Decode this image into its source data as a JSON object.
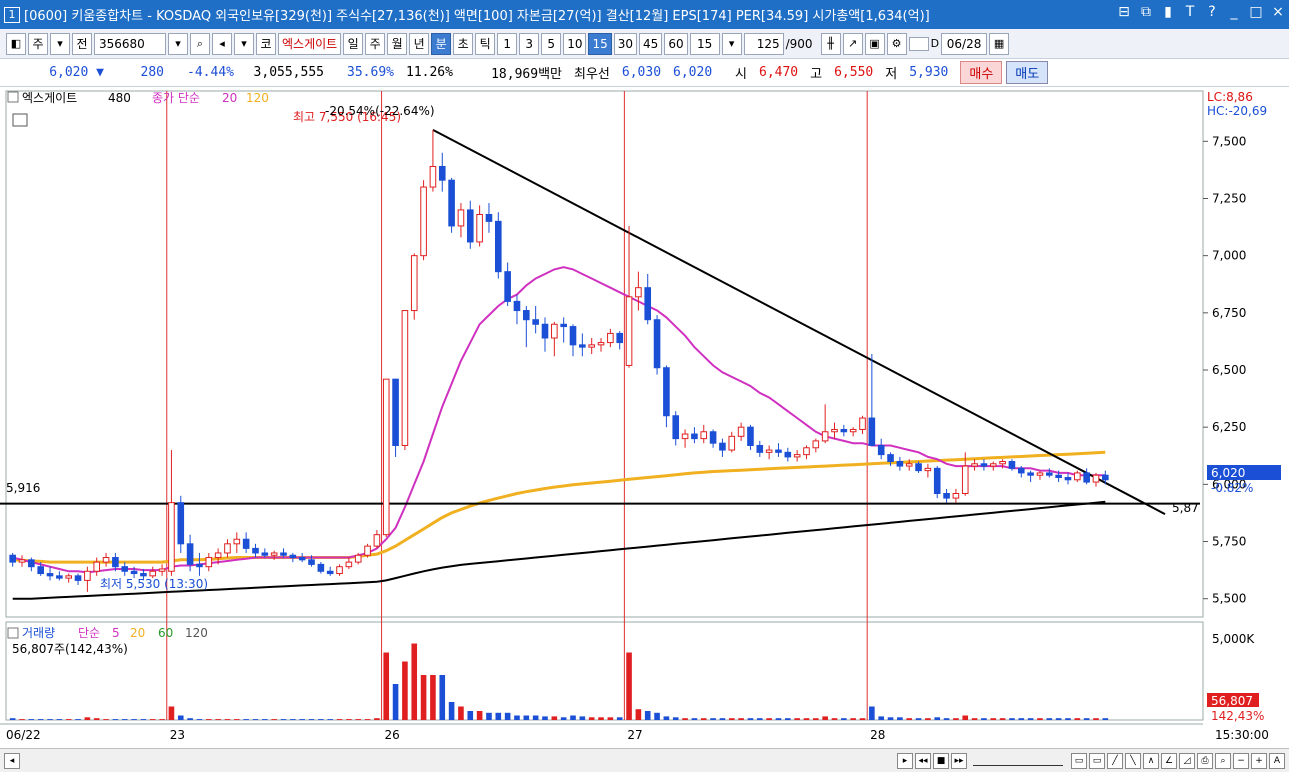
{
  "window": {
    "number": "1",
    "title": "[0600] 키움종합차트 - KOSDAQ 외국인보유[329(천)] 주식수[27,136(천)] 액면[100] 자본금[27(억)] 결산[12월] EPS[174] PER[34.59] 시가총액[1,634(억)]",
    "buttons": [
      "⊟",
      "⧉",
      "▮",
      "T",
      "?",
      "_",
      "□",
      "×"
    ]
  },
  "toolbar1": {
    "period_main": "주",
    "jeon": "전",
    "code": "356680",
    "ko": "코",
    "stock_name": "엑스게이트",
    "intervals": [
      "일",
      "주",
      "월",
      "년",
      "분",
      "초",
      "틱"
    ],
    "selected_interval": "분",
    "minutes": [
      "1",
      "3",
      "5",
      "10",
      "15",
      "30",
      "45",
      "60"
    ],
    "selected_minute": "15",
    "minute_select": "15",
    "count": "125",
    "count_total": "/900",
    "d_label": "D",
    "date": "06/28"
  },
  "quote": {
    "price": "6,020",
    "arrow": "▼",
    "change": "280",
    "change_pct": "-4.44%",
    "volume": "3,055,555",
    "ratio1": "35.69%",
    "ratio2": "11.26%",
    "amount": "18,969백만",
    "best_label": "최우선",
    "best_ask": "6,030",
    "best_bid": "6,020",
    "open_label": "시",
    "open": "6,470",
    "high_label": "고",
    "high": "6,550",
    "low_label": "저",
    "low": "5,930",
    "buy_label": "매수",
    "sell_label": "매도"
  },
  "chart_legend": {
    "name": "엑스게이트",
    "count": "480",
    "ma_label": "종가 단순",
    "ma_a": "20",
    "ma_b": "120",
    "high_label": "최고 7,550 (16:45)",
    "trend_label": "-20.54%(-22.64%)",
    "low_label": "최저 5,530 (13:30)",
    "hline_label": "5,916",
    "trend_end_label": "5,87",
    "lc": "LC:8,86",
    "hc": "HC:-20,69",
    "current_price": "6,020",
    "current_pct": "-0.82%"
  },
  "volume_legend": {
    "name": "거래량",
    "ma_label": "단순",
    "ma_a": "5",
    "ma_b": "20",
    "ma_c": "60",
    "ma_d": "120",
    "info": "56,807주(142,43%)",
    "axis_top": "5,000K",
    "current": "56,807",
    "current_pct": "142,43%"
  },
  "x_labels": [
    "06/22",
    "23",
    "26",
    "27",
    "28"
  ],
  "time_label": "15:30:00",
  "colors": {
    "up": "#e02020",
    "down": "#1a4fd6",
    "ma20": "#d030c0",
    "ma120": "#f0b020",
    "trend": "#000000"
  },
  "chart_data": {
    "type": "candlestick",
    "y_ticks": [
      5500,
      5750,
      6000,
      6250,
      6500,
      6750,
      7000,
      7250,
      7500
    ],
    "ylim": [
      5420,
      7720
    ],
    "day_labels": [
      "06/22",
      "23",
      "26",
      "27",
      "28"
    ],
    "hline": 5916,
    "candles": [
      [
        5690,
        5700,
        5640,
        5660
      ],
      [
        5660,
        5690,
        5640,
        5670
      ],
      [
        5670,
        5680,
        5620,
        5640
      ],
      [
        5640,
        5660,
        5600,
        5610
      ],
      [
        5610,
        5640,
        5580,
        5600
      ],
      [
        5600,
        5620,
        5580,
        5590
      ],
      [
        5590,
        5610,
        5570,
        5600
      ],
      [
        5600,
        5610,
        5560,
        5580
      ],
      [
        5580,
        5640,
        5530,
        5620
      ],
      [
        5620,
        5680,
        5600,
        5660
      ],
      [
        5660,
        5700,
        5640,
        5680
      ],
      [
        5680,
        5700,
        5620,
        5640
      ],
      [
        5640,
        5660,
        5600,
        5620
      ],
      [
        5620,
        5640,
        5590,
        5610
      ],
      [
        5610,
        5630,
        5580,
        5600
      ],
      [
        5600,
        5640,
        5590,
        5620
      ],
      [
        5620,
        5650,
        5600,
        5630
      ],
      [
        5620,
        6150,
        5600,
        5920
      ],
      [
        5920,
        5950,
        5700,
        5740
      ],
      [
        5740,
        5780,
        5620,
        5650
      ],
      [
        5650,
        5700,
        5600,
        5640
      ],
      [
        5640,
        5700,
        5620,
        5680
      ],
      [
        5680,
        5720,
        5650,
        5700
      ],
      [
        5700,
        5760,
        5680,
        5740
      ],
      [
        5740,
        5790,
        5700,
        5760
      ],
      [
        5760,
        5790,
        5700,
        5720
      ],
      [
        5720,
        5740,
        5680,
        5700
      ],
      [
        5700,
        5720,
        5680,
        5690
      ],
      [
        5690,
        5710,
        5670,
        5700
      ],
      [
        5700,
        5720,
        5680,
        5690
      ],
      [
        5690,
        5700,
        5660,
        5680
      ],
      [
        5680,
        5700,
        5660,
        5670
      ],
      [
        5670,
        5690,
        5640,
        5650
      ],
      [
        5650,
        5660,
        5610,
        5620
      ],
      [
        5620,
        5640,
        5600,
        5610
      ],
      [
        5610,
        5650,
        5600,
        5640
      ],
      [
        5640,
        5680,
        5630,
        5660
      ],
      [
        5660,
        5700,
        5650,
        5690
      ],
      [
        5690,
        5740,
        5680,
        5730
      ],
      [
        5730,
        5800,
        5720,
        5780
      ],
      [
        5780,
        6460,
        5770,
        6460
      ],
      [
        6460,
        6460,
        6120,
        6170
      ],
      [
        6170,
        6760,
        6150,
        6760
      ],
      [
        6760,
        7010,
        6720,
        7000
      ],
      [
        7000,
        7330,
        6980,
        7300
      ],
      [
        7300,
        7550,
        7280,
        7390
      ],
      [
        7390,
        7450,
        7280,
        7330
      ],
      [
        7330,
        7340,
        7100,
        7130
      ],
      [
        7130,
        7230,
        7080,
        7200
      ],
      [
        7200,
        7240,
        7030,
        7060
      ],
      [
        7060,
        7220,
        7040,
        7180
      ],
      [
        7180,
        7230,
        7100,
        7150
      ],
      [
        7150,
        7190,
        6900,
        6930
      ],
      [
        6930,
        6970,
        6780,
        6800
      ],
      [
        6800,
        6830,
        6700,
        6760
      ],
      [
        6760,
        6780,
        6600,
        6720
      ],
      [
        6720,
        6780,
        6660,
        6700
      ],
      [
        6700,
        6730,
        6580,
        6640
      ],
      [
        6640,
        6710,
        6560,
        6700
      ],
      [
        6700,
        6730,
        6620,
        6690
      ],
      [
        6690,
        6700,
        6560,
        6610
      ],
      [
        6610,
        6660,
        6560,
        6600
      ],
      [
        6600,
        6640,
        6570,
        6610
      ],
      [
        6610,
        6640,
        6580,
        6620
      ],
      [
        6620,
        6680,
        6600,
        6660
      ],
      [
        6660,
        6670,
        6590,
        6620
      ],
      [
        6520,
        7130,
        6510,
        6820
      ],
      [
        6820,
        6930,
        6760,
        6860
      ],
      [
        6860,
        6920,
        6700,
        6720
      ],
      [
        6720,
        6740,
        6480,
        6510
      ],
      [
        6510,
        6520,
        6250,
        6300
      ],
      [
        6300,
        6320,
        6170,
        6200
      ],
      [
        6200,
        6240,
        6160,
        6220
      ],
      [
        6220,
        6250,
        6180,
        6200
      ],
      [
        6200,
        6260,
        6180,
        6230
      ],
      [
        6230,
        6240,
        6160,
        6180
      ],
      [
        6180,
        6200,
        6120,
        6150
      ],
      [
        6150,
        6230,
        6140,
        6210
      ],
      [
        6210,
        6270,
        6190,
        6250
      ],
      [
        6250,
        6260,
        6150,
        6170
      ],
      [
        6170,
        6190,
        6120,
        6140
      ],
      [
        6140,
        6170,
        6110,
        6150
      ],
      [
        6150,
        6180,
        6120,
        6140
      ],
      [
        6140,
        6160,
        6100,
        6120
      ],
      [
        6120,
        6150,
        6100,
        6130
      ],
      [
        6130,
        6170,
        6110,
        6160
      ],
      [
        6160,
        6200,
        6140,
        6190
      ],
      [
        6190,
        6350,
        6180,
        6230
      ],
      [
        6230,
        6270,
        6200,
        6240
      ],
      [
        6240,
        6260,
        6210,
        6230
      ],
      [
        6230,
        6250,
        6210,
        6240
      ],
      [
        6240,
        6300,
        6220,
        6290
      ],
      [
        6290,
        6570,
        6170,
        6170
      ],
      [
        6170,
        6200,
        6110,
        6130
      ],
      [
        6130,
        6140,
        6080,
        6100
      ],
      [
        6100,
        6120,
        6060,
        6080
      ],
      [
        6080,
        6110,
        6060,
        6090
      ],
      [
        6090,
        6100,
        6050,
        6060
      ],
      [
        6060,
        6090,
        6030,
        6070
      ],
      [
        6070,
        6080,
        5940,
        5960
      ],
      [
        5960,
        5980,
        5920,
        5940
      ],
      [
        5940,
        5980,
        5920,
        5960
      ],
      [
        5960,
        6140,
        5950,
        6080
      ],
      [
        6080,
        6110,
        6060,
        6090
      ],
      [
        6090,
        6110,
        6060,
        6080
      ],
      [
        6080,
        6100,
        6060,
        6090
      ],
      [
        6090,
        6110,
        6070,
        6100
      ],
      [
        6100,
        6110,
        6060,
        6070
      ],
      [
        6070,
        6080,
        6030,
        6050
      ],
      [
        6050,
        6060,
        6010,
        6040
      ],
      [
        6040,
        6060,
        6020,
        6050
      ],
      [
        6050,
        6070,
        6030,
        6040
      ],
      [
        6040,
        6060,
        6010,
        6030
      ],
      [
        6030,
        6050,
        6000,
        6020
      ],
      [
        6020,
        6060,
        6010,
        6050
      ],
      [
        6050,
        6070,
        6000,
        6010
      ],
      [
        6010,
        6050,
        5990,
        6040
      ],
      [
        6040,
        6060,
        6000,
        6020
      ]
    ],
    "day_starts": [
      0,
      17,
      40,
      66,
      92
    ],
    "volumes": [
      0.02,
      0.01,
      0.01,
      0.01,
      0.01,
      0.01,
      0.01,
      0.01,
      0.03,
      0.02,
      0.01,
      0.01,
      0.01,
      0.01,
      0.01,
      0.01,
      0.01,
      0.15,
      0.05,
      0.02,
      0.01,
      0.01,
      0.01,
      0.01,
      0.01,
      0.01,
      0.01,
      0.01,
      0.01,
      0.01,
      0.01,
      0.01,
      0.01,
      0.01,
      0.01,
      0.01,
      0.01,
      0.01,
      0.01,
      0.02,
      0.75,
      0.4,
      0.65,
      0.85,
      0.5,
      0.5,
      0.5,
      0.2,
      0.15,
      0.1,
      0.1,
      0.08,
      0.08,
      0.08,
      0.05,
      0.05,
      0.05,
      0.04,
      0.04,
      0.03,
      0.05,
      0.04,
      0.03,
      0.03,
      0.03,
      0.03,
      0.75,
      0.12,
      0.1,
      0.08,
      0.04,
      0.03,
      0.02,
      0.02,
      0.02,
      0.02,
      0.02,
      0.02,
      0.02,
      0.02,
      0.02,
      0.02,
      0.02,
      0.02,
      0.02,
      0.02,
      0.02,
      0.04,
      0.02,
      0.02,
      0.02,
      0.02,
      0.15,
      0.04,
      0.03,
      0.03,
      0.02,
      0.02,
      0.02,
      0.03,
      0.02,
      0.02,
      0.05,
      0.02,
      0.02,
      0.02,
      0.02,
      0.02,
      0.02,
      0.02,
      0.02,
      0.02,
      0.02,
      0.02,
      0.02,
      0.02,
      0.02,
      0.02
    ],
    "ma20": [
      5680,
      5670,
      5660,
      5650,
      5640,
      5630,
      5620,
      5620,
      5615,
      5620,
      5625,
      5630,
      5630,
      5630,
      5625,
      5625,
      5625,
      5640,
      5645,
      5645,
      5650,
      5655,
      5660,
      5665,
      5670,
      5675,
      5680,
      5680,
      5680,
      5680,
      5680,
      5680,
      5680,
      5680,
      5680,
      5680,
      5680,
      5690,
      5700,
      5720,
      5760,
      5810,
      5900,
      6000,
      6100,
      6220,
      6340,
      6440,
      6540,
      6620,
      6700,
      6740,
      6780,
      6810,
      6830,
      6870,
      6900,
      6920,
      6940,
      6950,
      6940,
      6920,
      6900,
      6880,
      6860,
      6840,
      6820,
      6800,
      6780,
      6760,
      6730,
      6690,
      6650,
      6600,
      6560,
      6520,
      6490,
      6470,
      6450,
      6430,
      6400,
      6380,
      6350,
      6320,
      6290,
      6260,
      6230,
      6210,
      6200,
      6190,
      6180,
      6180,
      6170,
      6170,
      6170,
      6160,
      6150,
      6140,
      6120,
      6110,
      6090,
      6080,
      6080,
      6080,
      6080,
      6080,
      6080,
      6070,
      6070,
      6070,
      6060,
      6060,
      6050,
      6050,
      6040,
      6040,
      6040,
      6040,
      6040
    ],
    "ma120": [
      5670,
      5668,
      5665,
      5663,
      5660,
      5660,
      5660,
      5660,
      5660,
      5660,
      5660,
      5660,
      5660,
      5660,
      5660,
      5660,
      5660,
      5665,
      5670,
      5670,
      5670,
      5672,
      5675,
      5678,
      5680,
      5680,
      5680,
      5680,
      5680,
      5680,
      5680,
      5680,
      5680,
      5680,
      5680,
      5680,
      5680,
      5685,
      5690,
      5695,
      5710,
      5730,
      5755,
      5780,
      5805,
      5830,
      5855,
      5875,
      5890,
      5905,
      5918,
      5930,
      5940,
      5950,
      5960,
      5968,
      5975,
      5982,
      5988,
      5993,
      5998,
      6002,
      6006,
      6010,
      6014,
      6018,
      6022,
      6026,
      6030,
      6034,
      6038,
      6042,
      6046,
      6050,
      6053,
      6056,
      6058,
      6060,
      6062,
      6064,
      6066,
      6068,
      6070,
      6072,
      6074,
      6076,
      6078,
      6080,
      6082,
      6084,
      6086,
      6088,
      6090,
      6092,
      6094,
      6096,
      6098,
      6100,
      6102,
      6104,
      6106,
      6108,
      6110,
      6112,
      6114,
      6116,
      6118,
      6120,
      6122,
      6124,
      6126,
      6128,
      6130,
      6132,
      6134,
      6136,
      6138,
      6140,
      6142,
      6144,
      6146
    ],
    "ma60_long": [
      5500,
      5500,
      5500,
      5502,
      5504,
      5506,
      5508,
      5510,
      5512,
      5514,
      5516,
      5518,
      5520,
      5522,
      5524,
      5526,
      5528,
      5530,
      5532,
      5534,
      5536,
      5538,
      5540,
      5542,
      5544,
      5546,
      5548,
      5550,
      5552,
      5554,
      5556,
      5558,
      5560,
      5562,
      5564,
      5566,
      5568,
      5570,
      5572,
      5574,
      5580,
      5590,
      5600,
      5610,
      5620,
      5628,
      5636,
      5642,
      5648,
      5652,
      5656,
      5660,
      5664,
      5668,
      5672,
      5676,
      5680,
      5684,
      5688,
      5692,
      5696,
      5700,
      5704,
      5708,
      5712,
      5716,
      5720,
      5724,
      5728,
      5732,
      5736,
      5740,
      5744,
      5748,
      5752,
      5756,
      5760,
      5764,
      5768,
      5772,
      5776,
      5780,
      5784,
      5788,
      5792,
      5796,
      5800,
      5804,
      5808,
      5812,
      5816,
      5820,
      5824,
      5828,
      5832,
      5836,
      5840,
      5844,
      5848,
      5852,
      5856,
      5860,
      5864,
      5868,
      5872,
      5876,
      5880,
      5884,
      5888,
      5892,
      5896,
      5900,
      5904,
      5908,
      5912,
      5916,
      5920,
      5924,
      5928,
      5932,
      5936,
      5940
    ]
  }
}
